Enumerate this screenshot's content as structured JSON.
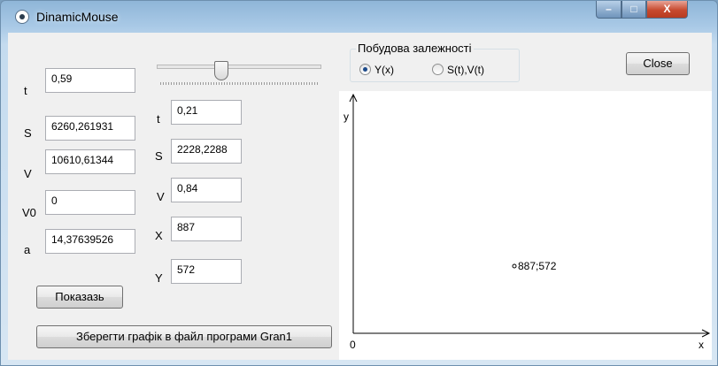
{
  "window": {
    "title": "DinamicMouse",
    "min_glyph": "–",
    "max_glyph": "□",
    "close_glyph": "X"
  },
  "left_fields": [
    {
      "label": "t",
      "value": "0,59"
    },
    {
      "label": "S",
      "value": "6260,261931"
    },
    {
      "label": "V",
      "value": "10610,61344"
    },
    {
      "label": "V0",
      "value": "0"
    },
    {
      "label": "a",
      "value": "14,37639526"
    }
  ],
  "middle_fields": [
    {
      "label": "t",
      "value": "0,21"
    },
    {
      "label": "S",
      "value": "2228,2288"
    },
    {
      "label": "V",
      "value": "0,84"
    },
    {
      "label": "X",
      "value": "887"
    },
    {
      "label": "Y",
      "value": "572"
    }
  ],
  "slider": {
    "level_fraction": 0.38
  },
  "buttons": {
    "show": "Показазь",
    "save": "Зберегти графік в файл програми Gran1",
    "close": "Close"
  },
  "group": {
    "title": "Побудова залежності",
    "options": [
      {
        "label": "Y(x)",
        "selected": true
      },
      {
        "label": "S(t),V(t)",
        "selected": false
      }
    ]
  },
  "plot": {
    "y_axis_label": "y",
    "x_axis_label": "x",
    "origin_label": "0",
    "point_label": "887;572"
  }
}
